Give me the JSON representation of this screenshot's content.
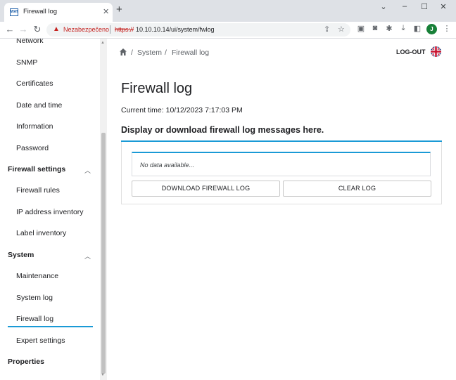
{
  "browser": {
    "tab_title": "Firewall log",
    "tab_favicon_text": "WAT",
    "security_label": "Nezabezpečeno",
    "url_scheme": "https://",
    "url_rest": "10.10.10.14/ui/system/fwlog",
    "profile_initial": "J",
    "window_controls": [
      "⌄",
      "–",
      "☐",
      "✕"
    ]
  },
  "sidebar": {
    "items_top": [
      "Network",
      "SNMP",
      "Certificates",
      "Date and time",
      "Information",
      "Password"
    ],
    "group_firewall": "Firewall settings",
    "items_firewall": [
      "Firewall rules",
      "IP address inventory",
      "Label inventory"
    ],
    "group_system": "System",
    "items_system": [
      "Maintenance",
      "System log",
      "Firewall log",
      "Expert settings"
    ],
    "group_properties": "Properties",
    "active_item": "Firewall log"
  },
  "breadcrumb": {
    "separator": "/",
    "items": [
      "System",
      "Firewall log"
    ]
  },
  "header": {
    "logout_label": "LOG-OUT"
  },
  "page": {
    "title": "Firewall log",
    "current_time": "Current time: 10/12/2023 7:17:03 PM",
    "description": "Display or download firewall log messages here.",
    "no_data": "No data available...",
    "download_button": "DOWNLOAD FIREWALL LOG",
    "clear_button": "CLEAR LOG"
  },
  "colors": {
    "accent": "#1a9ad6",
    "warning": "#c5221f"
  }
}
